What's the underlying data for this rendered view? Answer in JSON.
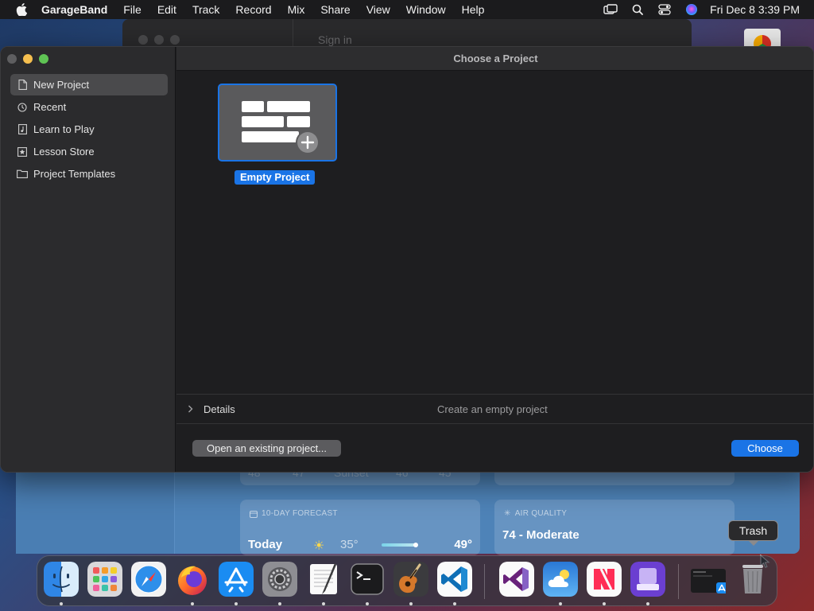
{
  "menubar": {
    "app_name": "GarageBand",
    "menus": [
      "File",
      "Edit",
      "Track",
      "Record",
      "Mix",
      "Share",
      "View",
      "Window",
      "Help"
    ],
    "clock": "Fri Dec 8  3:39 PM",
    "status_icons": [
      "screen-mirroring-icon",
      "spotlight-search-icon",
      "control-center-icon",
      "siri-icon"
    ]
  },
  "background_windows": {
    "browser_sign_in": "Sign in",
    "weather": {
      "top_card_faded_values": [
        "48",
        "47",
        "Sunset",
        "46",
        "45"
      ],
      "forecast_caption": "10-DAY FORECAST",
      "forecast_day": "Today",
      "forecast_low": "35°",
      "forecast_high": "49°",
      "air_caption": "AIR QUALITY",
      "air_value": "74 - Moderate"
    }
  },
  "window": {
    "title": "Choose a Project",
    "sidebar": [
      {
        "label": "New Project",
        "icon": "document-icon",
        "selected": true
      },
      {
        "label": "Recent",
        "icon": "clock-icon",
        "selected": false
      },
      {
        "label": "Learn to Play",
        "icon": "music-note-icon",
        "selected": false
      },
      {
        "label": "Lesson Store",
        "icon": "star-icon",
        "selected": false
      },
      {
        "label": "Project Templates",
        "icon": "folder-icon",
        "selected": false
      }
    ],
    "project": {
      "label": "Empty Project",
      "icon": "empty-project-icon"
    },
    "details": {
      "label": "Details",
      "description": "Create an empty project"
    },
    "buttons": {
      "open_existing": "Open an existing project...",
      "choose": "Choose"
    }
  },
  "tooltip": "Trash",
  "dock": {
    "apps": [
      "Finder",
      "Launchpad",
      "Safari",
      "Firefox",
      "App Store",
      "System Settings",
      "TextEdit",
      "Terminal",
      "GarageBand",
      "Visual Studio Code",
      "Visual Studio",
      "Weather",
      "News",
      "Apple Configurator",
      "Recent App Window",
      "Trash"
    ],
    "running": [
      "Finder",
      "Firefox",
      "App Store",
      "System Settings",
      "TextEdit",
      "Terminal",
      "GarageBand",
      "Visual Studio Code",
      "Weather",
      "News",
      "Apple Configurator"
    ]
  },
  "colors": {
    "accent": "#1a74e6",
    "window_bg": "#1e1e20",
    "sidebar_bg": "#2b2b2d",
    "selected_row": "#4a4a4c"
  }
}
